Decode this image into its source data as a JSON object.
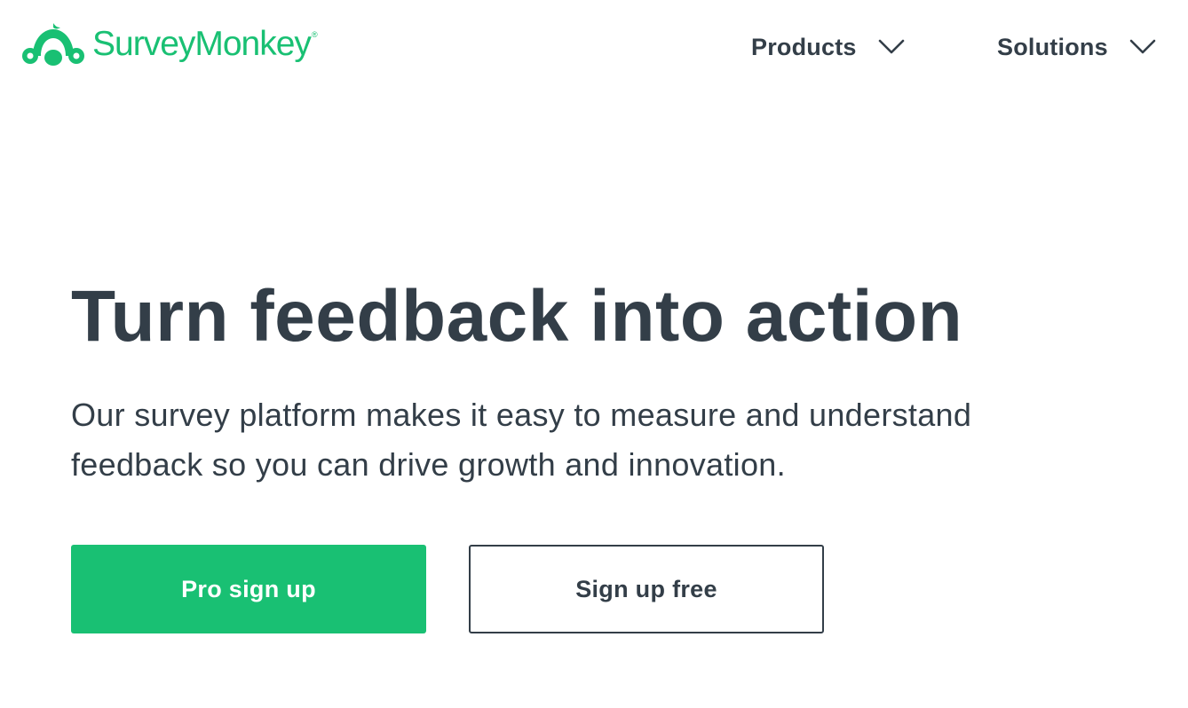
{
  "colors": {
    "brand_green": "#19c073",
    "text_dark": "#333e48",
    "background": "#ffffff"
  },
  "header": {
    "logo": {
      "icon": "surveymonkey-logo-icon",
      "text": "SurveyMonkey",
      "registered_mark": "®"
    },
    "nav": [
      {
        "label": "Products",
        "icon": "chevron-down-icon"
      },
      {
        "label": "Solutions",
        "icon": "chevron-down-icon"
      }
    ]
  },
  "hero": {
    "title": "Turn feedback into action",
    "subtitle": "Our survey platform makes it easy to measure and understand feedback so you can drive growth and innovation.",
    "buttons": {
      "primary": "Pro sign up",
      "secondary": "Sign up free"
    }
  }
}
